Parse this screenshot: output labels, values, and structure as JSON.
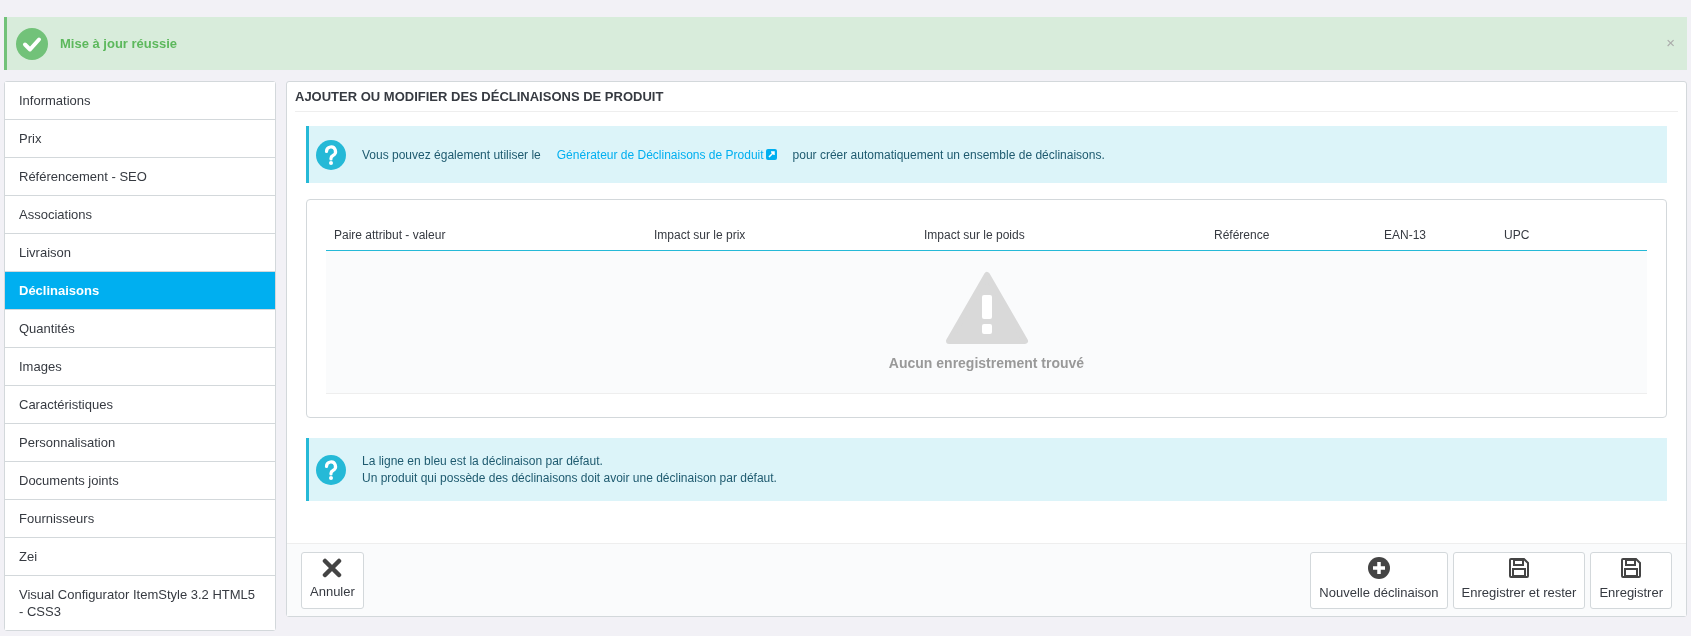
{
  "alert": {
    "text": "Mise à jour réussie",
    "close": "×"
  },
  "sidebar": {
    "items": [
      {
        "label": "Informations",
        "selected": false
      },
      {
        "label": "Prix",
        "selected": false
      },
      {
        "label": "Référencement - SEO",
        "selected": false
      },
      {
        "label": "Associations",
        "selected": false
      },
      {
        "label": "Livraison",
        "selected": false
      },
      {
        "label": "Déclinaisons",
        "selected": true
      },
      {
        "label": "Quantités",
        "selected": false
      },
      {
        "label": "Images",
        "selected": false
      },
      {
        "label": "Caractéristiques",
        "selected": false
      },
      {
        "label": "Personnalisation",
        "selected": false
      },
      {
        "label": "Documents joints",
        "selected": false
      },
      {
        "label": "Fournisseurs",
        "selected": false
      },
      {
        "label": "Zei",
        "selected": false
      },
      {
        "label": "Visual Configurator ItemStyle 3.2 HTML5 - CSS3",
        "selected": false
      }
    ]
  },
  "panel": {
    "title": "AJOUTER OU MODIFIER DES DÉCLINAISONS DE PRODUIT",
    "info": {
      "before": "Vous pouvez également utiliser le",
      "link": "Générateur de Déclinaisons de Produit",
      "after": "pour créer automatiquement un ensemble de déclinaisons."
    },
    "table": {
      "columns": [
        "Paire attribut - valeur",
        "Impact sur le prix",
        "Impact sur le poids",
        "Référence",
        "EAN-13",
        "UPC"
      ],
      "empty": "Aucun enregistrement trouvé"
    },
    "note": {
      "lines": [
        "La ligne en bleu est la déclinaison par défaut.",
        "Un produit qui possède des déclinaisons doit avoir une déclinaison par défaut."
      ]
    },
    "buttons_left": [
      {
        "label": "Annuler",
        "kind": "cancel"
      }
    ],
    "buttons_right": [
      {
        "label": "Nouvelle déclinaison",
        "kind": "add"
      },
      {
        "label": "Enregistrer et rester",
        "kind": "save"
      },
      {
        "label": "Enregistrer",
        "kind": "save"
      }
    ]
  }
}
